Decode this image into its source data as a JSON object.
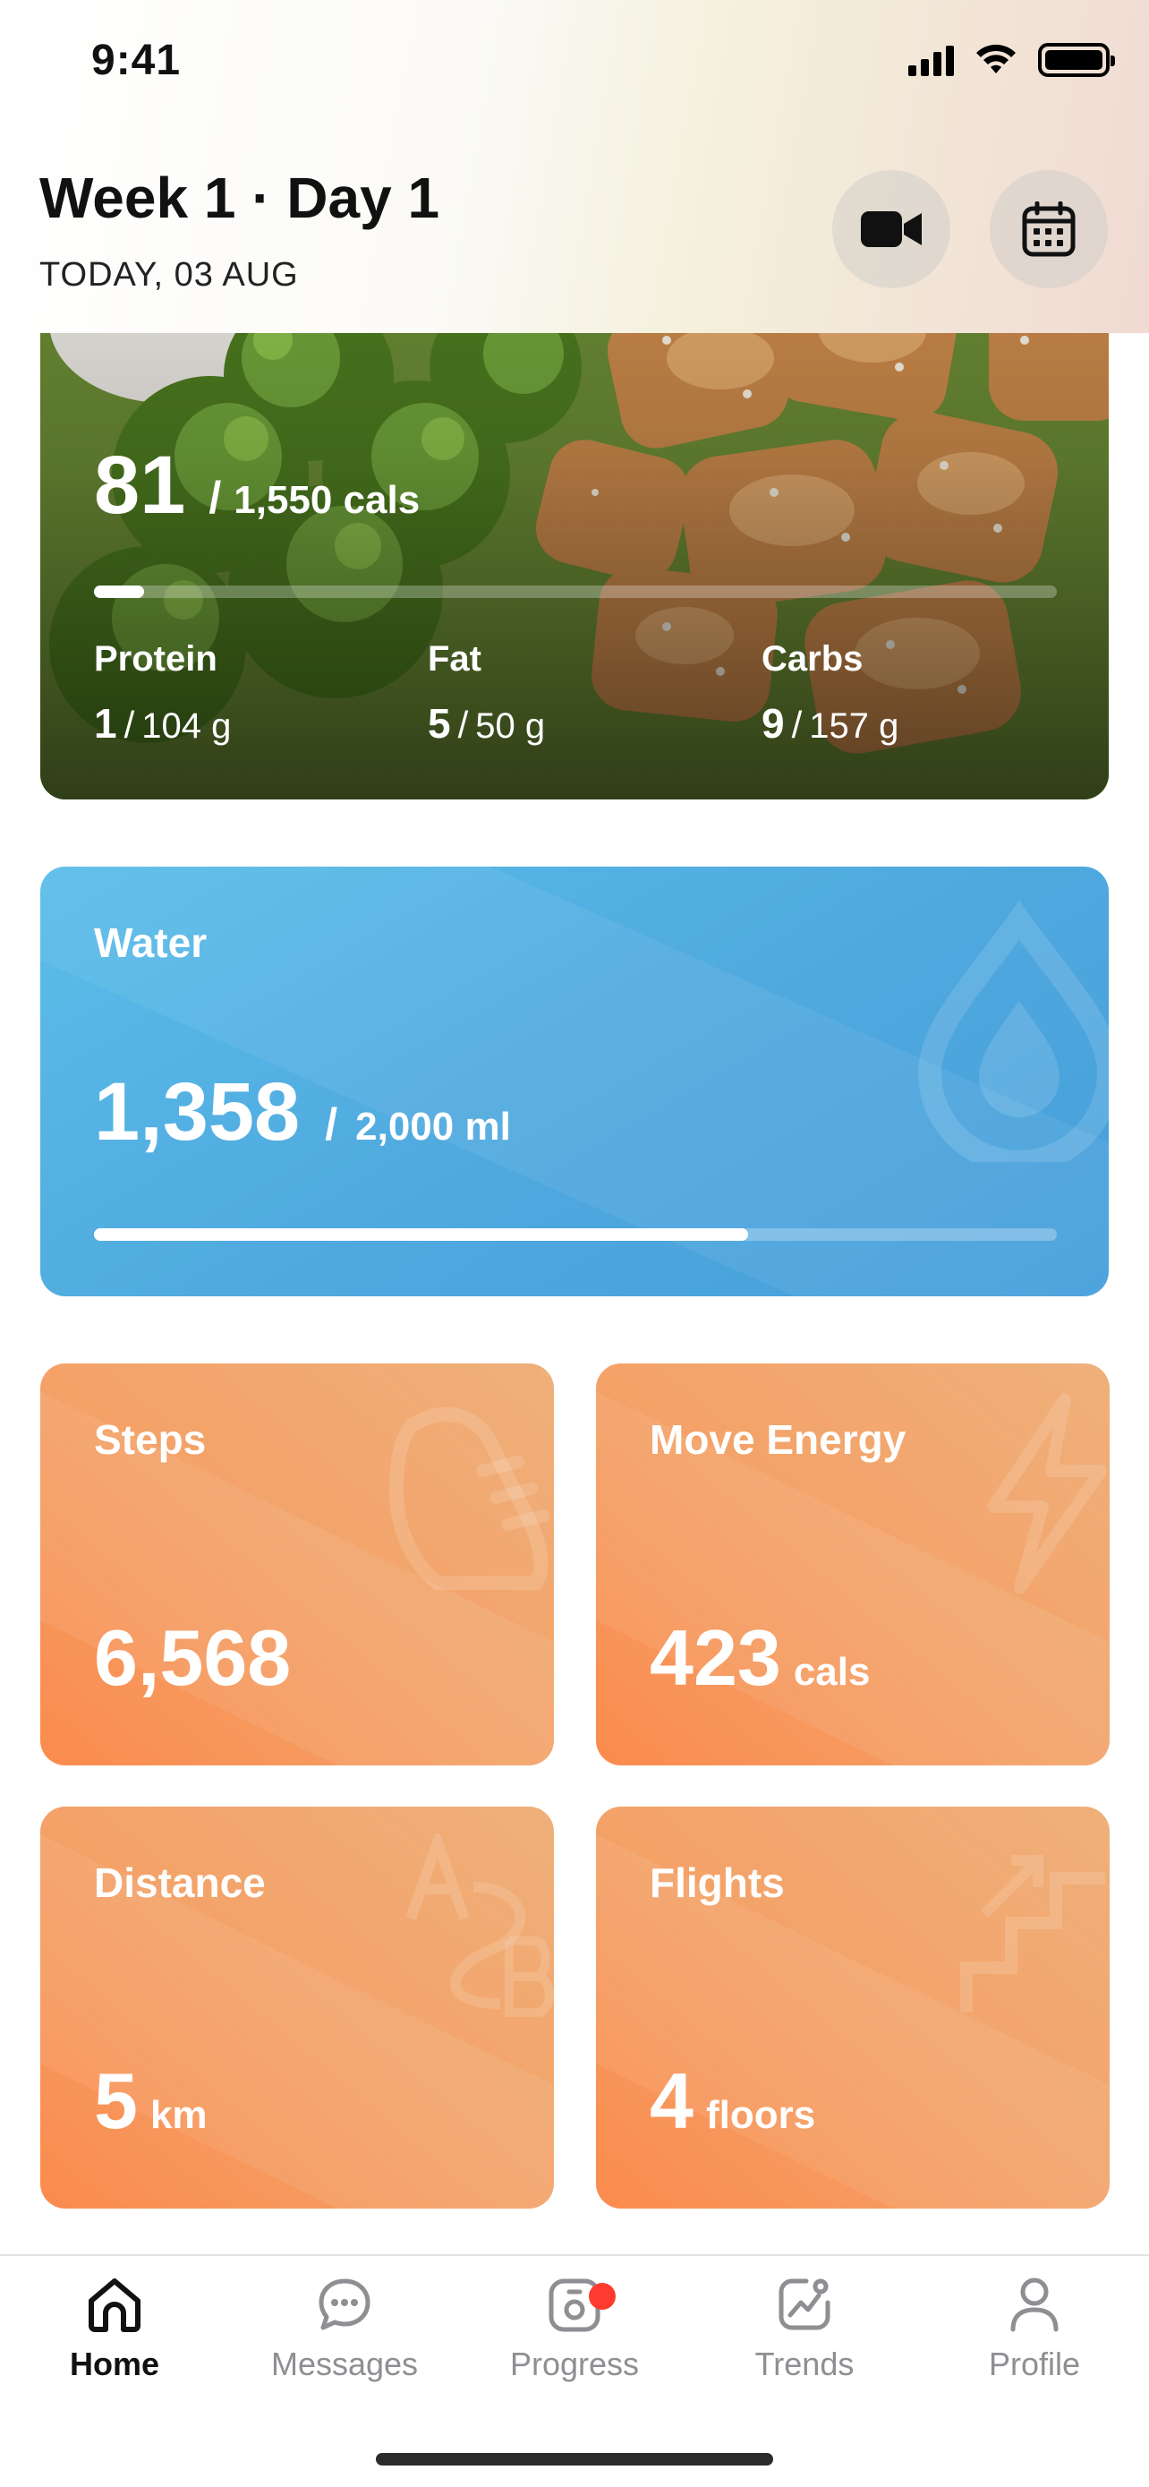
{
  "status_bar": {
    "time": "9:41"
  },
  "header": {
    "title": "Week 1 · Day 1",
    "date": "TODAY, 03 AUG"
  },
  "calories": {
    "consumed": "81",
    "separator": "/",
    "goal": "1,550 cals",
    "progress_fraction": 0.052,
    "macros": [
      {
        "label": "Protein",
        "current": "1",
        "separator": "/",
        "goal": "104 g"
      },
      {
        "label": "Fat",
        "current": "5",
        "separator": "/",
        "goal": "50 g"
      },
      {
        "label": "Carbs",
        "current": "9",
        "separator": "/",
        "goal": "157 g"
      }
    ]
  },
  "water": {
    "title": "Water",
    "value": "1,358",
    "separator": "/",
    "goal": "2,000 ml",
    "progress_fraction": 0.679
  },
  "tiles": {
    "steps": {
      "title": "Steps",
      "value": "6,568",
      "icon": "shoe-icon"
    },
    "energy": {
      "title": "Move Energy",
      "value": "423",
      "unit": "cals",
      "icon": "lightning-icon"
    },
    "distance": {
      "title": "Distance",
      "value": "5",
      "unit": "km",
      "icon": "a-to-b-icon"
    },
    "flights": {
      "title": "Flights",
      "value": "4",
      "unit": "floors",
      "icon": "stairs-icon"
    }
  },
  "tabbar": {
    "tabs": [
      {
        "label": "Home",
        "icon": "home-icon",
        "active": true
      },
      {
        "label": "Messages",
        "icon": "chat-bubble-icon"
      },
      {
        "label": "Progress",
        "icon": "scale-icon",
        "badge": true
      },
      {
        "label": "Trends",
        "icon": "chart-icon"
      },
      {
        "label": "Profile",
        "icon": "person-icon"
      }
    ]
  },
  "colors": {
    "water_card": "#4fa8de",
    "tile_orange": "#f4a167",
    "badge_red": "#ff3b30",
    "active_tab": "#111111",
    "inactive_tab": "#8e8e93"
  }
}
